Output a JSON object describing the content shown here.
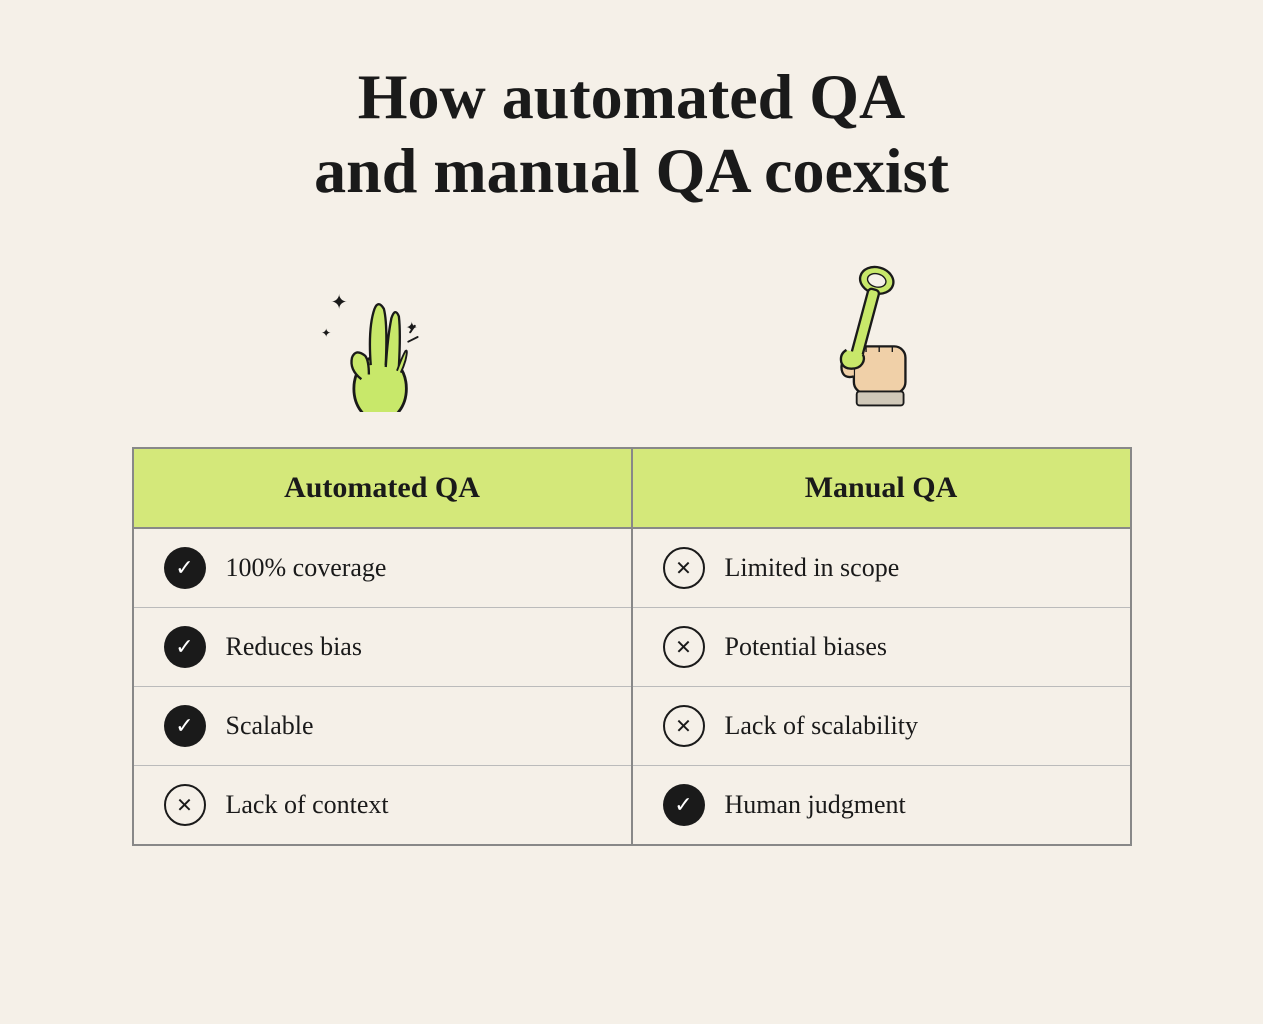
{
  "title": {
    "line1": "How automated QA",
    "line2": "and manual QA coexist"
  },
  "table": {
    "col1_header": "Automated QA",
    "col2_header": "Manual QA",
    "col1_items": [
      {
        "type": "check",
        "text": "100% coverage"
      },
      {
        "type": "check",
        "text": "Reduces bias"
      },
      {
        "type": "check",
        "text": "Scalable"
      },
      {
        "type": "x",
        "text": "Lack of context"
      }
    ],
    "col2_items": [
      {
        "type": "x",
        "text": "Limited in scope"
      },
      {
        "type": "x",
        "text": "Potential biases"
      },
      {
        "type": "x",
        "text": "Lack of scalability"
      },
      {
        "type": "check",
        "text": "Human judgment"
      }
    ]
  },
  "icons": {
    "left_alt": "hand snap icon",
    "right_alt": "wrench icon"
  }
}
